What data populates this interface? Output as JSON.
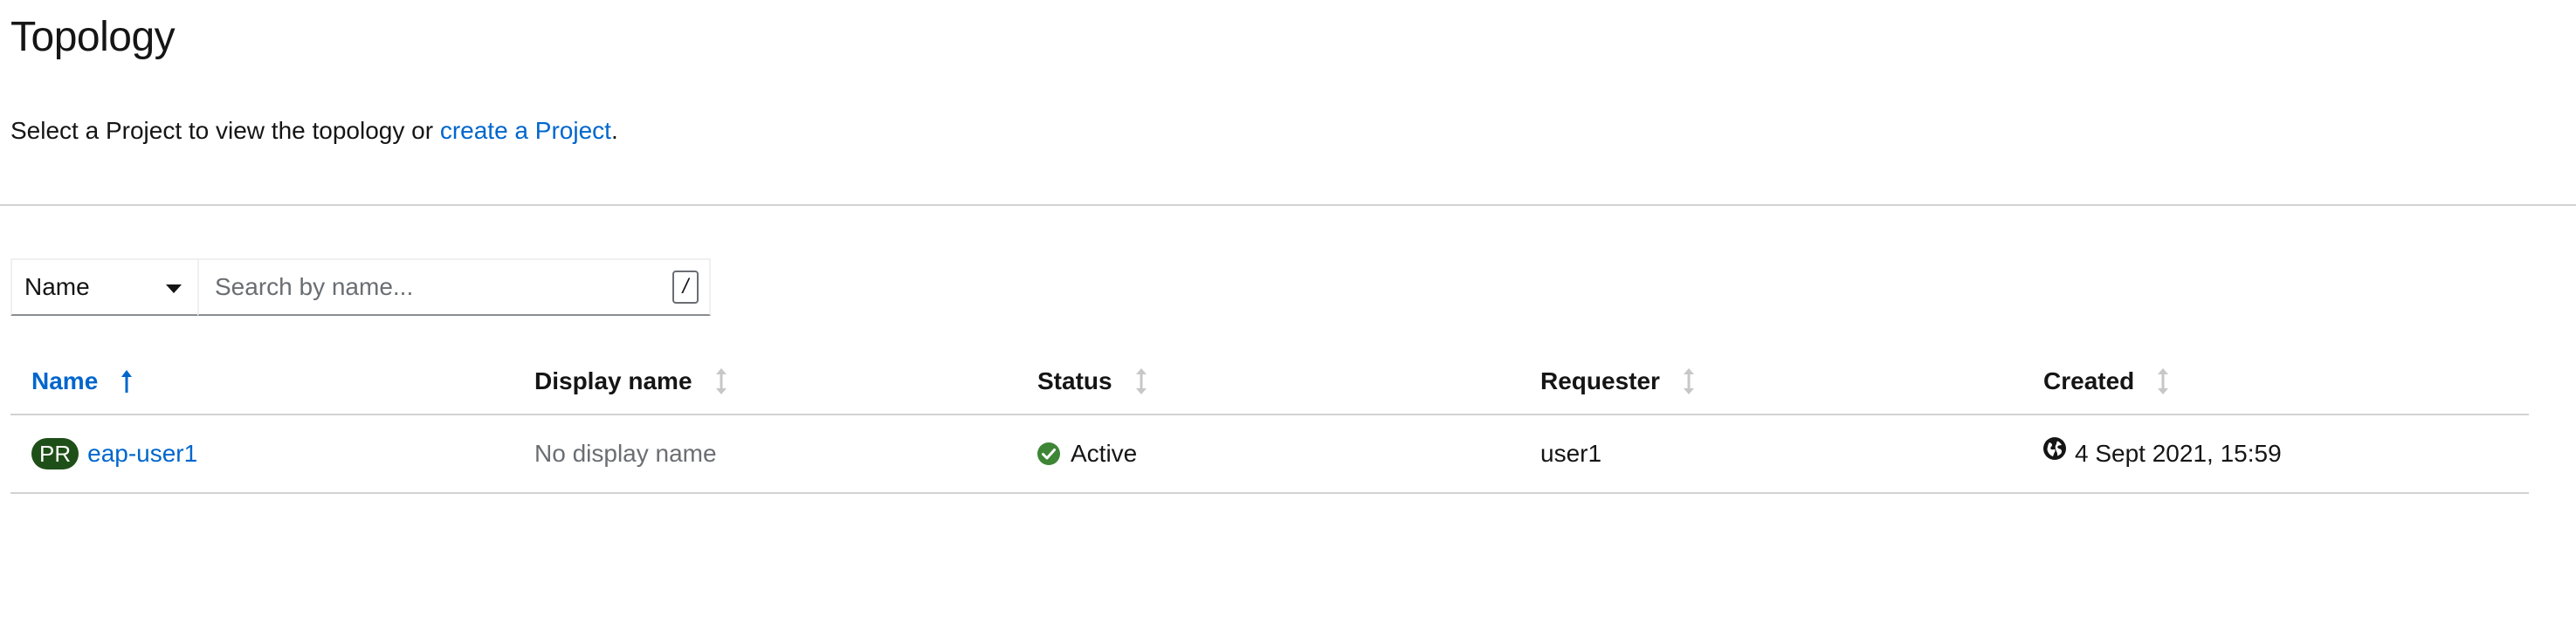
{
  "page": {
    "title": "Topology",
    "intro_prefix": "Select a Project to view the topology or ",
    "intro_link": "create a Project",
    "intro_suffix": "."
  },
  "toolbar": {
    "filter_label": "Name",
    "search_placeholder": "Search by name...",
    "shortcut_hint": "/"
  },
  "table": {
    "columns": [
      {
        "label": "Name",
        "sorted": "ascending"
      },
      {
        "label": "Display name"
      },
      {
        "label": "Status"
      },
      {
        "label": "Requester"
      },
      {
        "label": "Created"
      }
    ],
    "rows": [
      {
        "badge": "PR",
        "name": "eap-user1",
        "display_name": "No display name",
        "status": "Active",
        "requester": "user1",
        "created": "4 Sept 2021, 15:59"
      }
    ]
  },
  "colors": {
    "link": "#0066cc",
    "status_active": "#3e8635",
    "badge_bg": "#1e4f18",
    "divider": "#d2d2d2"
  },
  "icons": {
    "sort_active": "arrow-up-icon",
    "sort_inactive": "sort-icon",
    "status": "check-circle-icon",
    "created": "globe-icon",
    "filter_dropdown": "caret-down-icon"
  }
}
